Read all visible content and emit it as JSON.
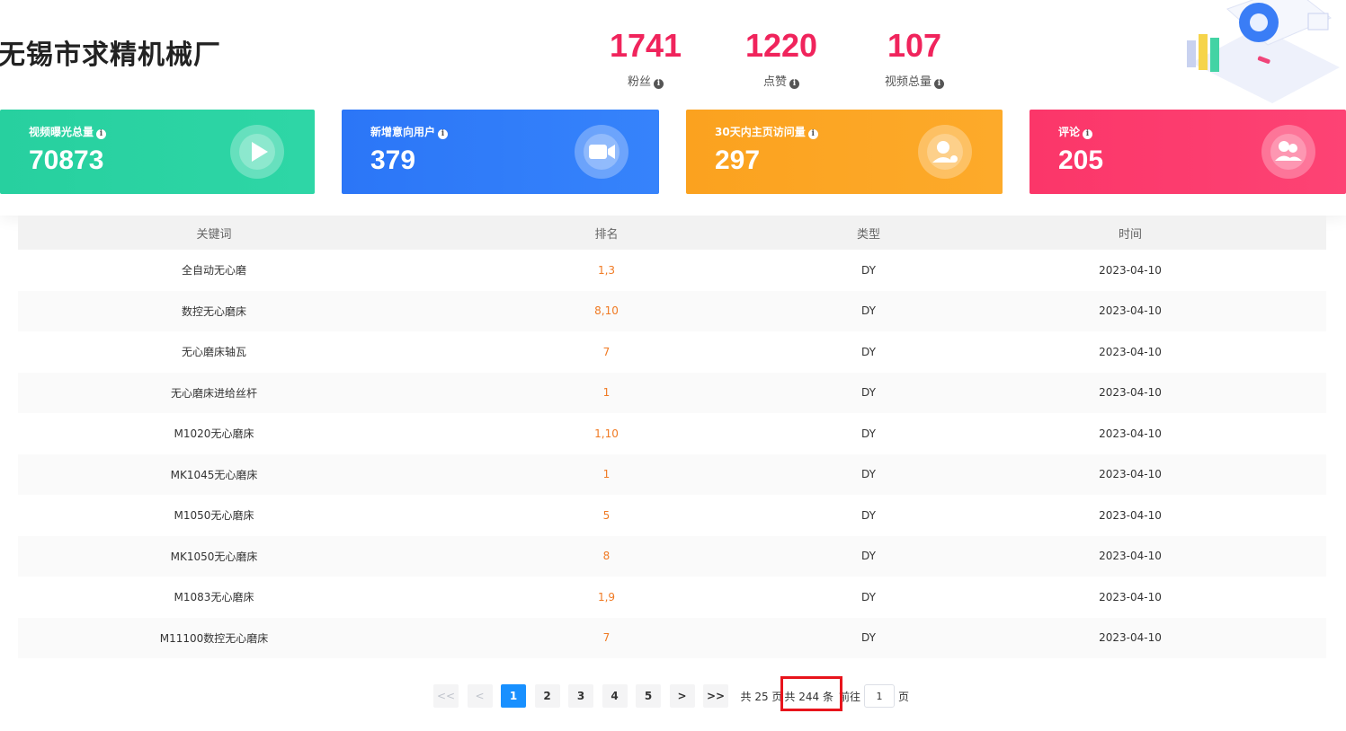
{
  "header": {
    "company_name": "无锡市求精机械厂",
    "stats": [
      {
        "value": "1741",
        "label": "粉丝"
      },
      {
        "value": "1220",
        "label": "点赞"
      },
      {
        "value": "107",
        "label": "视频总量"
      }
    ]
  },
  "cards": [
    {
      "title": "视频曝光总量",
      "value": "70873",
      "color": "#2ad3a0",
      "icon": "play-icon"
    },
    {
      "title": "新增意向用户",
      "value": "379",
      "color": "#2f7bf8",
      "icon": "video-camera-icon"
    },
    {
      "title": "30天内主页访问量",
      "value": "297",
      "color": "#fca420",
      "icon": "user-visit-icon"
    },
    {
      "title": "评论",
      "value": "205",
      "color": "#fc3a6a",
      "icon": "users-icon"
    }
  ],
  "table": {
    "headers": [
      "关键词",
      "排名",
      "类型",
      "时间"
    ],
    "rows": [
      [
        "全自动无心磨",
        "1,3",
        "DY",
        "2023-04-10"
      ],
      [
        "数控无心磨床",
        "8,10",
        "DY",
        "2023-04-10"
      ],
      [
        "无心磨床轴瓦",
        "7",
        "DY",
        "2023-04-10"
      ],
      [
        "无心磨床进给丝杆",
        "1",
        "DY",
        "2023-04-10"
      ],
      [
        "M1020无心磨床",
        "1,10",
        "DY",
        "2023-04-10"
      ],
      [
        "MK1045无心磨床",
        "1",
        "DY",
        "2023-04-10"
      ],
      [
        "M1050无心磨床",
        "5",
        "DY",
        "2023-04-10"
      ],
      [
        "MK1050无心磨床",
        "8",
        "DY",
        "2023-04-10"
      ],
      [
        "M1083无心磨床",
        "1,9",
        "DY",
        "2023-04-10"
      ],
      [
        "M11100数控无心磨床",
        "7",
        "DY",
        "2023-04-10"
      ]
    ]
  },
  "pagination": {
    "first": "<<",
    "prev": "<",
    "pages": [
      "1",
      "2",
      "3",
      "4",
      "5"
    ],
    "active_page": "1",
    "next": ">",
    "last": ">>",
    "total_pages_text": "共 25 页",
    "total_items_text": "共 244 条",
    "goto_label": "前往",
    "goto_value": "1",
    "page_suffix": "页"
  }
}
